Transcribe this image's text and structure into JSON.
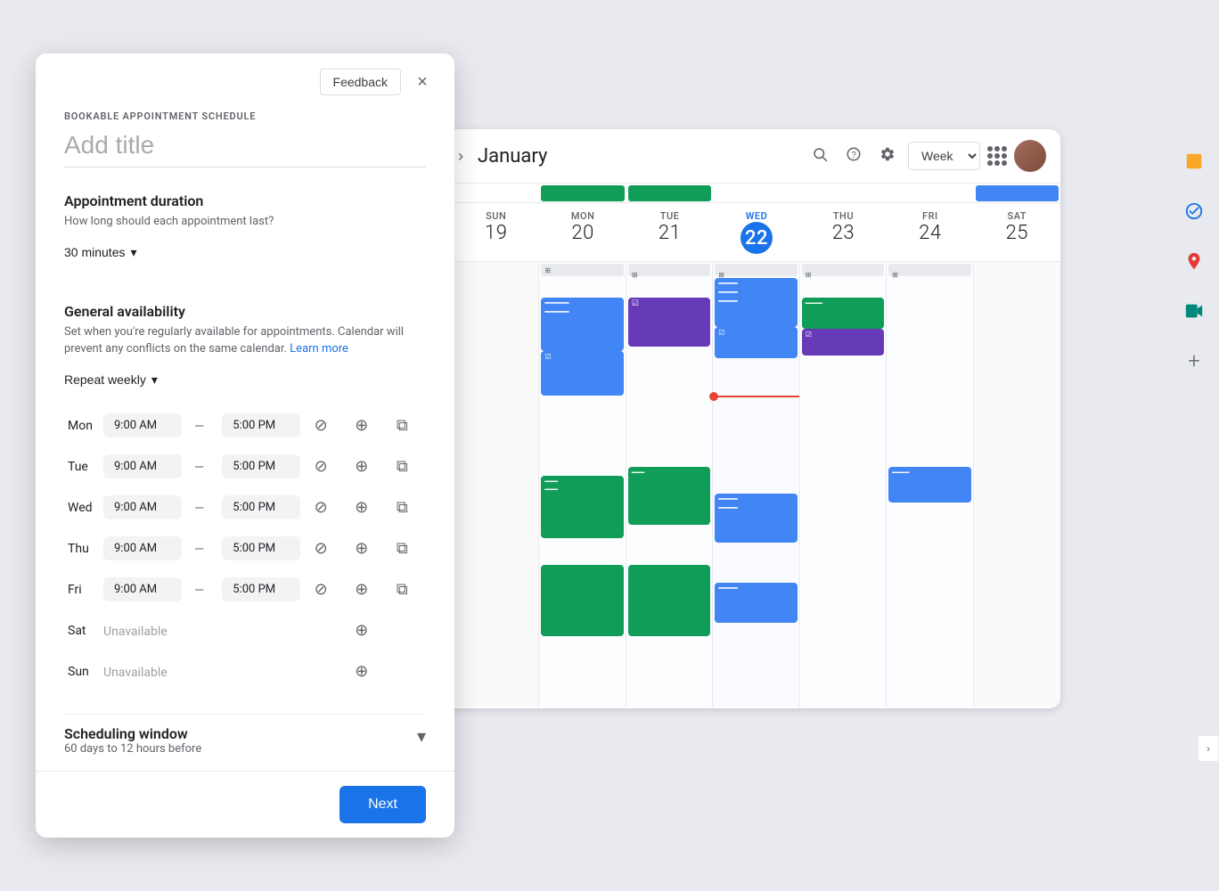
{
  "modal": {
    "feedback_label": "Feedback",
    "close_icon": "×",
    "section_label": "BOOKABLE APPOINTMENT SCHEDULE",
    "title_placeholder": "Add title",
    "duration_section": {
      "title": "Appointment duration",
      "desc": "How long should each appointment last?",
      "value": "30 minutes"
    },
    "availability_section": {
      "title": "General availability",
      "desc": "Set when you're regularly available for appointments. Calendar will prevent any conflicts on the same calendar.",
      "learn_more": "Learn more",
      "repeat": "Repeat weekly",
      "days": [
        {
          "day": "Mon",
          "start": "9:00 AM",
          "end": "5:00 PM",
          "available": true
        },
        {
          "day": "Tue",
          "start": "9:00 AM",
          "end": "5:00 PM",
          "available": true
        },
        {
          "day": "Wed",
          "start": "9:00 AM",
          "end": "5:00 PM",
          "available": true
        },
        {
          "day": "Thu",
          "start": "9:00 AM",
          "end": "5:00 PM",
          "available": true
        },
        {
          "day": "Fri",
          "start": "9:00 AM",
          "end": "5:00 PM",
          "available": true
        },
        {
          "day": "Sat",
          "start": "",
          "end": "",
          "available": false,
          "label": "Unavailable"
        },
        {
          "day": "Sun",
          "start": "",
          "end": "",
          "available": false,
          "label": "Unavailable"
        }
      ]
    },
    "scheduling_window": {
      "title": "Scheduling window",
      "desc": "60 days to 12 hours before"
    },
    "next_button": "Next"
  },
  "calendar": {
    "month": "January",
    "view": "Week",
    "days": [
      {
        "name": "SUN",
        "num": "19",
        "today": false
      },
      {
        "name": "MON",
        "num": "20",
        "today": false
      },
      {
        "name": "TUE",
        "num": "21",
        "today": false
      },
      {
        "name": "WED",
        "num": "22",
        "today": true
      },
      {
        "name": "THU",
        "num": "23",
        "today": false
      },
      {
        "name": "FRI",
        "num": "24",
        "today": false
      },
      {
        "name": "SAT",
        "num": "25",
        "today": false
      }
    ]
  },
  "icons": {
    "prev": "‹",
    "next": "›",
    "search": "🔍",
    "help": "?",
    "settings": "⚙",
    "grid": "⠿",
    "chevron_down": "▾",
    "plus": "+",
    "expand": "›"
  }
}
